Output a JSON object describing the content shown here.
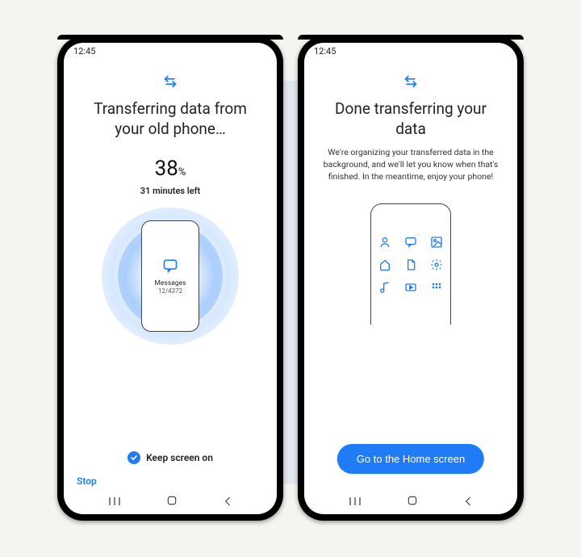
{
  "status_time": "12:45",
  "left": {
    "title": "Transferring data from your old phone…",
    "percent": "38",
    "percent_sign": "%",
    "eta": "31 minutes left",
    "current_item_label": "Messages",
    "current_item_count": "12/4372",
    "keep_screen_label": "Keep screen on",
    "keep_screen_checked": true,
    "stop_label": "Stop"
  },
  "right": {
    "title": "Done transferring your data",
    "subtext": "We're organizing your transferred data in the background, and we'll let you know when that's finished. In the meantime, enjoy your phone!",
    "icons": [
      "contact",
      "messages",
      "image",
      "home",
      "document",
      "settings",
      "music",
      "video",
      "apps"
    ],
    "cta_label": "Go to the Home screen"
  },
  "colors": {
    "primary": "#1f7bf6"
  }
}
